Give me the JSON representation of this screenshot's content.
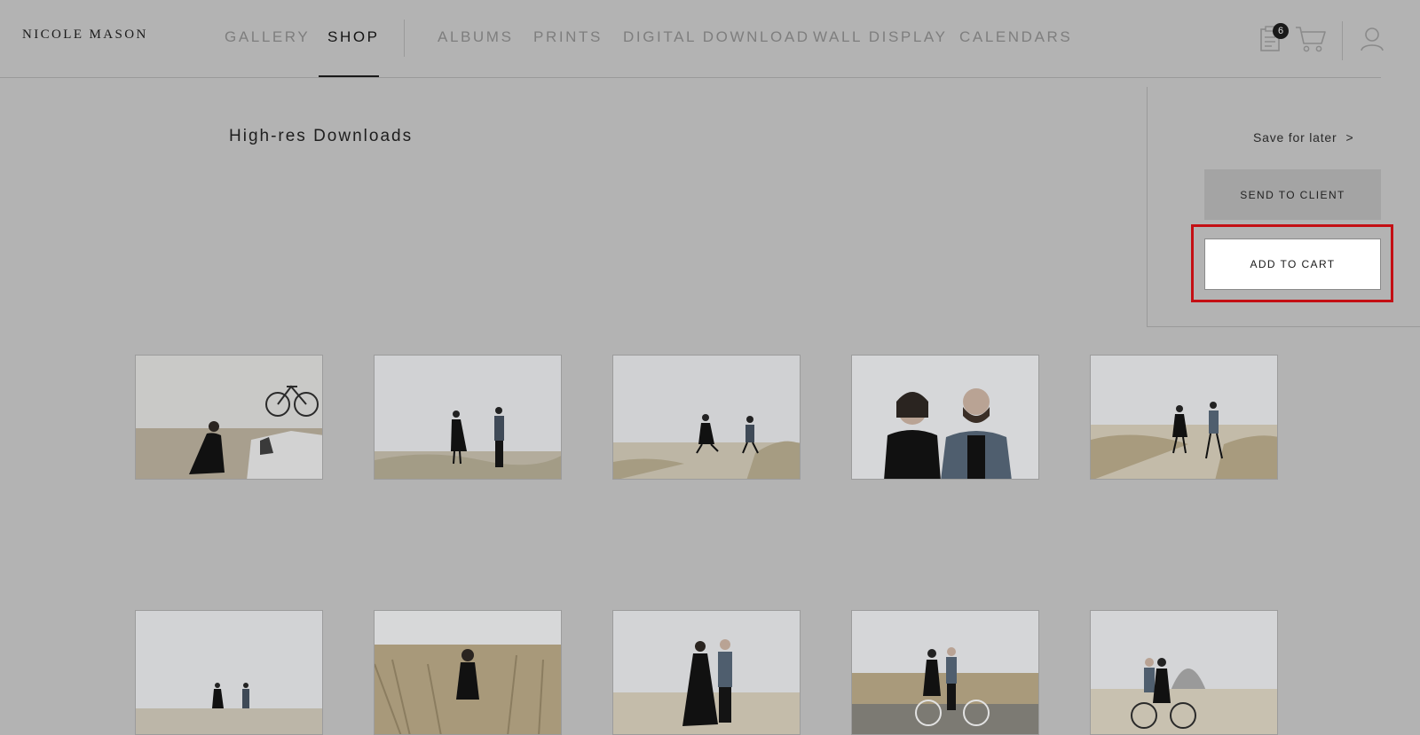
{
  "brand": "NICOLE MASON",
  "nav": {
    "primary": [
      {
        "label": "GALLERY",
        "active": false
      },
      {
        "label": "SHOP",
        "active": true
      }
    ],
    "secondary": [
      "ALBUMS",
      "PRINTS",
      "DIGITAL DOWNLOAD",
      "WALL DISPLAY",
      "CALENDARS"
    ]
  },
  "header_icons": {
    "clipboard": "clipboard-icon",
    "clipboard_badge": "6",
    "cart": "cart-icon",
    "user": "user-icon"
  },
  "panel": {
    "save_later": "Save for later",
    "save_later_chevron": ">",
    "send_to_client": "SEND TO CLIENT",
    "add_to_cart": "ADD TO CART",
    "highlight_color": "#c40f14"
  },
  "section_title": "High-res Downloads",
  "thumbnails": [
    {
      "description_icon": "photo-couple-car-bicycle"
    },
    {
      "description_icon": "photo-couple-beach-binoculars"
    },
    {
      "description_icon": "photo-couple-running-dunes"
    },
    {
      "description_icon": "photo-couple-closeup"
    },
    {
      "description_icon": "photo-couple-walking-dunes"
    },
    {
      "description_icon": "photo-couple-distant-beach"
    },
    {
      "description_icon": "photo-woman-grass"
    },
    {
      "description_icon": "photo-couple-sand"
    },
    {
      "description_icon": "photo-couple-bicycle"
    },
    {
      "description_icon": "photo-couple-bicycle-rock"
    }
  ]
}
